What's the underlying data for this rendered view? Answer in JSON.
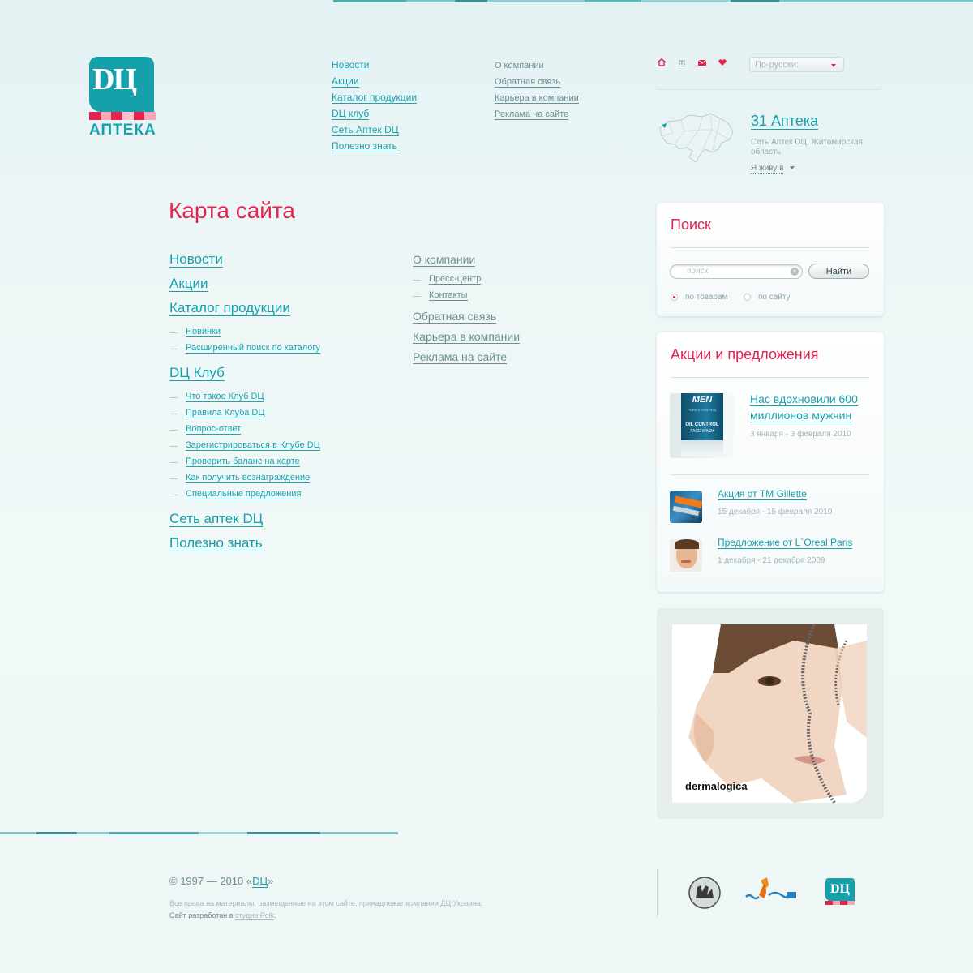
{
  "logo": {
    "mark": "DЦ",
    "text": "АПТЕКА"
  },
  "top_nav_main": [
    "Новости",
    "Акции",
    "Каталог продукции",
    "DЦ клуб",
    "Сеть Аптек DЦ",
    "Полезно знать"
  ],
  "top_nav_company": [
    "О компании",
    "Обратная связь",
    "Карьера в компании",
    "Реклама на сайте"
  ],
  "utility_icons": [
    "home-icon",
    "sitemap-icon",
    "mail-icon",
    "heart-icon"
  ],
  "language": {
    "selected": "По-русски:"
  },
  "city": {
    "title": "31 Аптека",
    "subtitle": "Сеть Аптек DЦ, Житомирская область",
    "live_in": "Я живу в"
  },
  "page_title": "Карта сайта",
  "sitemap": {
    "news": "Новости",
    "promos": "Акции",
    "catalog": "Каталог продукции",
    "catalog_sub": [
      "Новинки",
      "Расширенный поиск по каталогу"
    ],
    "club": "DЦ Клуб",
    "club_sub": [
      "Что такое Клуб DЦ",
      "Правила Клуба DЦ",
      "Вопрос-ответ",
      "Зарегистрироваться в Клубе DЦ",
      "Проверить баланс на карте",
      "Как получить вознаграждение",
      "Специальные предложения"
    ],
    "network": "Сеть аптек DЦ",
    "useful": "Полезно знать",
    "about": "О компании",
    "about_sub": [
      "Пресс-центр",
      "Контакты"
    ],
    "feedback": "Обратная связь",
    "career": "Карьера в компании",
    "ads": "Реклама на сайте"
  },
  "search": {
    "title": "Поиск",
    "placeholder": "поиск",
    "button": "Найти",
    "option_goods": "по товарам",
    "option_site": "по сайту"
  },
  "offers": {
    "title": "Акции и предложения",
    "items": [
      {
        "title": "Нас вдохновили 600 миллионов мужчин",
        "dates": "3 января - 3 февраля 2010"
      },
      {
        "title": "Акция от ТМ Gillette",
        "dates": "15 декабря - 15 февраля 2010"
      },
      {
        "title": "Предложение от L`Oreal Paris",
        "dates": "1 декабря - 21 декабря 2009"
      }
    ],
    "product_text": [
      "MEN",
      "PURE & CONTROL",
      "OIL CONTROL",
      "FACE WASH"
    ]
  },
  "banner": {
    "brand": "dermalogica"
  },
  "footer": {
    "copy_prefix": "© 1997 — 2010 «",
    "copy_link": "DЦ",
    "copy_suffix": "»",
    "rights": "Все права на материалы, размещенные на этом сайте, принадлежат компании ДЦ Украина.",
    "dev_prefix": "Сайт разработан в ",
    "dev_link": "студии Polk",
    "dev_suffix": "."
  },
  "partner_logos": {
    "third_mark": "DЦ"
  },
  "colors": {
    "accent": "#e3244f",
    "teal": "#16a0ab",
    "text": "#6d8a8d"
  }
}
